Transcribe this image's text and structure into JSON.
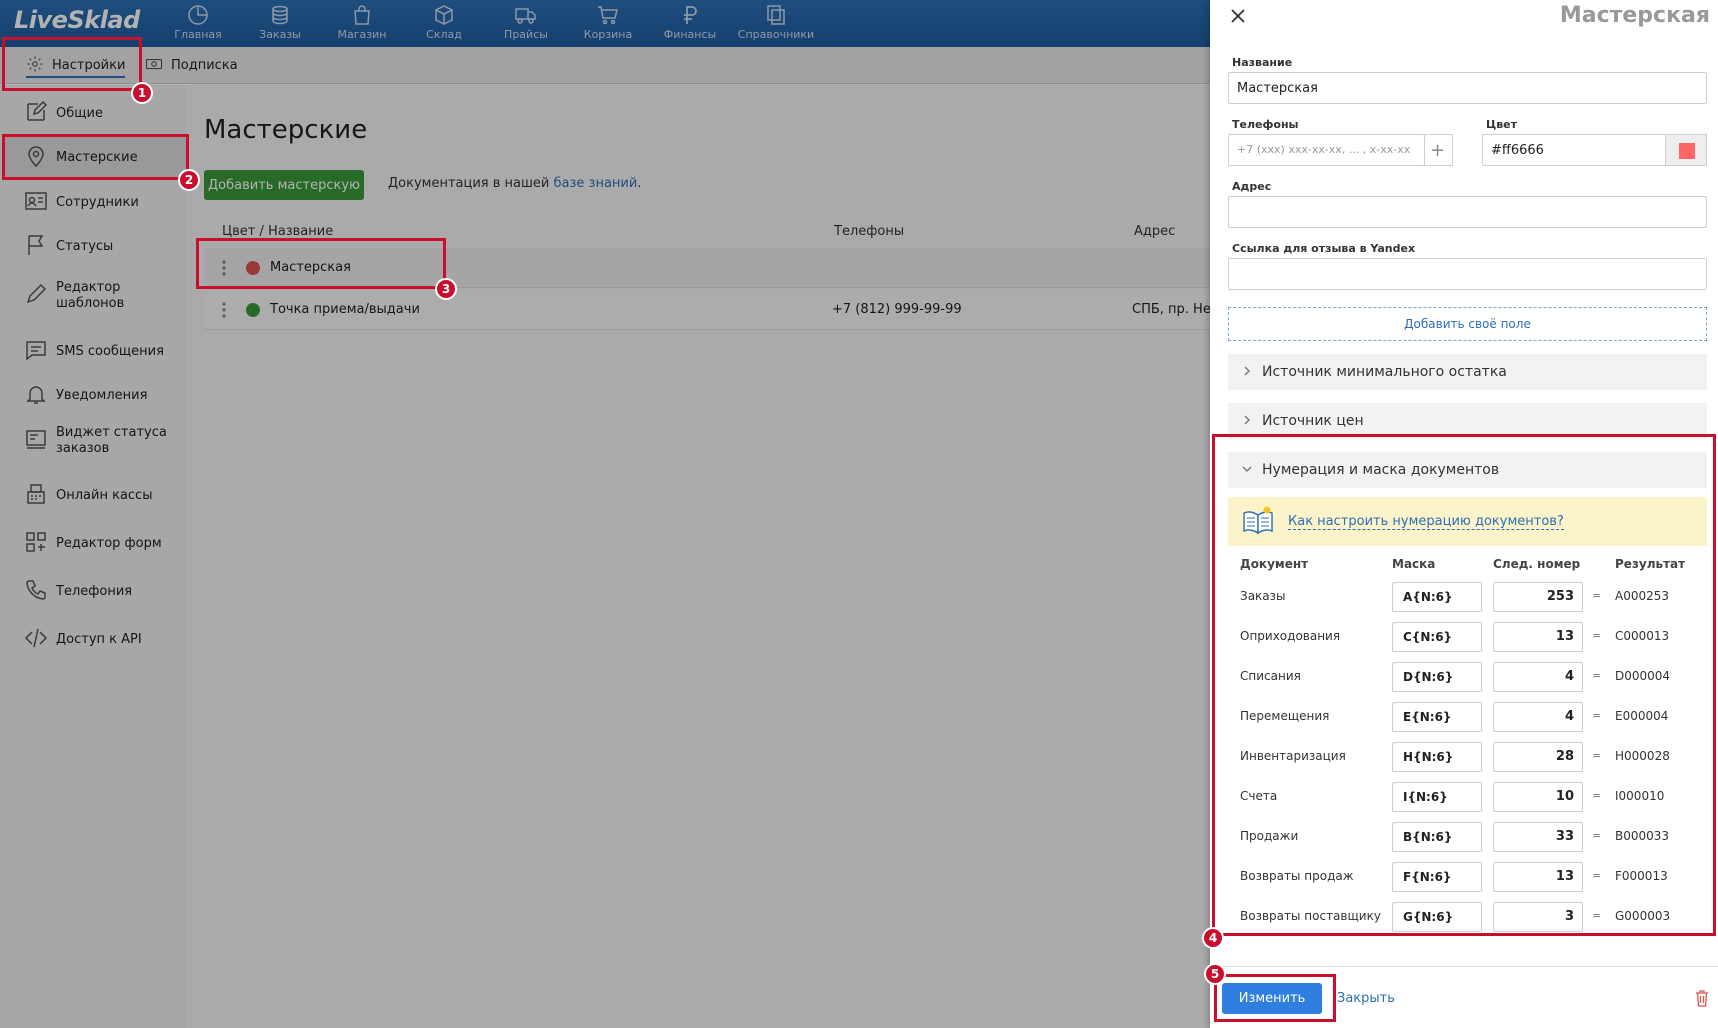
{
  "app": {
    "logo": "LiveSklad"
  },
  "nav": [
    {
      "label": "Главная",
      "icon": "pie-chart-icon"
    },
    {
      "label": "Заказы",
      "icon": "coins-icon"
    },
    {
      "label": "Магазин",
      "icon": "shopping-bag-icon"
    },
    {
      "label": "Склад",
      "icon": "box-icon"
    },
    {
      "label": "Прайсы",
      "icon": "truck-icon"
    },
    {
      "label": "Корзина",
      "icon": "cart-icon"
    },
    {
      "label": "Финансы",
      "icon": "ruble-icon"
    },
    {
      "label": "Справочники",
      "icon": "copy-icon"
    }
  ],
  "subtabs": {
    "settings": "Настройки",
    "subscription": "Подписка"
  },
  "sidebar": [
    {
      "label": "Общие",
      "icon": "edit-icon"
    },
    {
      "label": "Мастерские",
      "icon": "location-pin-icon"
    },
    {
      "label": "Сотрудники",
      "icon": "id-card-icon"
    },
    {
      "label": "Статусы",
      "icon": "flag-icon"
    },
    {
      "label": "Редактор\nшаблонов",
      "icon": "pen-icon"
    },
    {
      "label": "SMS сообщения",
      "icon": "message-icon"
    },
    {
      "label": "Уведомления",
      "icon": "bell-icon"
    },
    {
      "label": "Виджет статуса\nзаказов",
      "icon": "widget-icon"
    },
    {
      "label": "Онлайн кассы",
      "icon": "cash-register-icon"
    },
    {
      "label": "Редактор форм",
      "icon": "form-icon"
    },
    {
      "label": "Телефония",
      "icon": "phone-icon"
    },
    {
      "label": "Доступ к API",
      "icon": "code-icon"
    }
  ],
  "main": {
    "title": "Мастерские",
    "add_button": "Добавить мастерскую",
    "doc_text": "Документация в нашей",
    "doc_link": "базе знаний",
    "doc_dot": ".",
    "columns": {
      "name": "Цвет / Название",
      "phones": "Телефоны",
      "address": "Адрес"
    },
    "rows": [
      {
        "name": "Мастерская",
        "phone": "",
        "address": "",
        "color": "#d9534f"
      },
      {
        "name": "Точка приема/выдачи",
        "phone": "+7 (812) 999-99-99",
        "address": "СПБ, пр. Нев",
        "color": "#3a9a3a"
      }
    ]
  },
  "panel": {
    "title": "Мастерская",
    "name_label": "Название",
    "name_value": "Мастерская",
    "phones_label": "Телефоны",
    "phones_placeholder": "+7 (xxx) xxx-xx-xx, ... , x-xx-xx",
    "color_label": "Цвет",
    "color_value": "#ff6666",
    "address_label": "Адрес",
    "review_label": "Ссылка для отзыва в Yandex",
    "add_field": "Добавить своё поле",
    "acc_min_stock": "Источник минимального остатка",
    "acc_prices": "Источник цен",
    "acc_numbering": "Нумерация и маска документов",
    "hint_link": "Как настроить нумерацию документов?",
    "table_headers": {
      "doc": "Документ",
      "mask": "Маска",
      "next": "След. номер",
      "result": "Результат"
    },
    "eq": "=",
    "numbering": [
      {
        "doc": "Заказы",
        "mask": "A{N:6}",
        "next": "253",
        "result": "A000253"
      },
      {
        "doc": "Оприходования",
        "mask": "C{N:6}",
        "next": "13",
        "result": "C000013"
      },
      {
        "doc": "Списания",
        "mask": "D{N:6}",
        "next": "4",
        "result": "D000004"
      },
      {
        "doc": "Перемещения",
        "mask": "E{N:6}",
        "next": "4",
        "result": "E000004"
      },
      {
        "doc": "Инвентаризация",
        "mask": "H{N:6}",
        "next": "28",
        "result": "H000028"
      },
      {
        "doc": "Счета",
        "mask": "I{N:6}",
        "next": "10",
        "result": "I000010"
      },
      {
        "doc": "Продажи",
        "mask": "B{N:6}",
        "next": "33",
        "result": "B000033"
      },
      {
        "doc": "Возвраты продаж",
        "mask": "F{N:6}",
        "next": "13",
        "result": "F000013"
      },
      {
        "doc": "Возвраты поставщику",
        "mask": "G{N:6}",
        "next": "3",
        "result": "G000003"
      }
    ],
    "save_button": "Изменить",
    "close_button": "Закрыть"
  },
  "markers": [
    "1",
    "2",
    "3",
    "4",
    "5"
  ],
  "colors": {
    "accent": "#2d6fb5",
    "marker": "#c8102e",
    "green": "#3a9a3a",
    "save": "#2f7fe0"
  }
}
